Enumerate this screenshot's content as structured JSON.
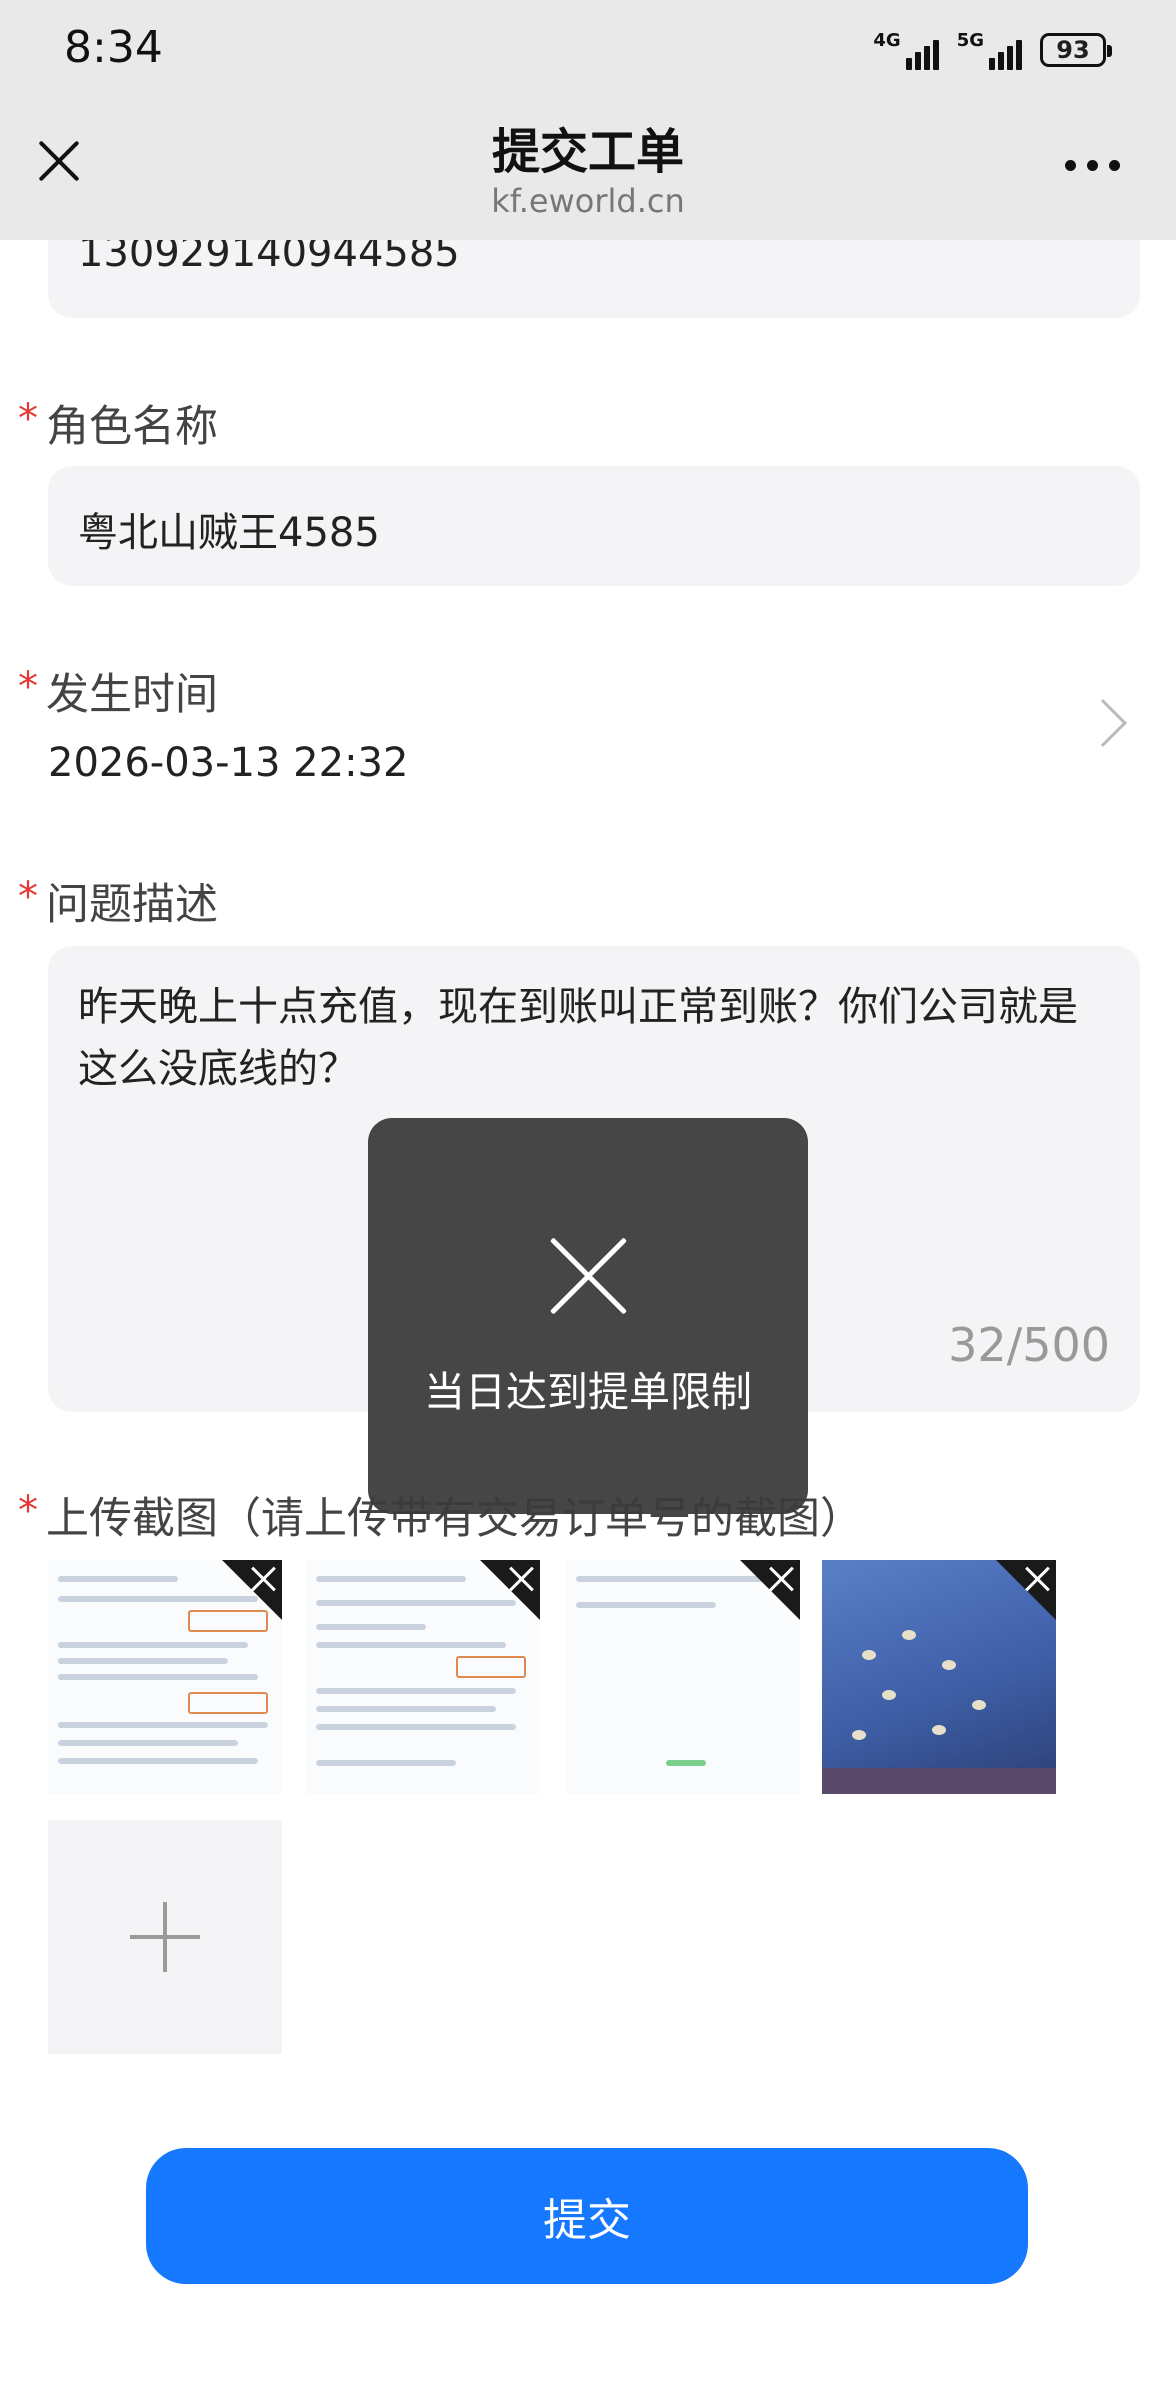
{
  "status_bar": {
    "time": "8:34",
    "network_1": "4G",
    "network_2": "5G",
    "battery": "93"
  },
  "nav": {
    "title": "提交工单",
    "subtitle": "kf.eworld.cn"
  },
  "form": {
    "order_value": "130929140944585",
    "role_label": "角色名称",
    "role_value": "粤北山贼王4585",
    "time_label": "发生时间",
    "time_value": "2026-03-13 22:32",
    "desc_label": "问题描述",
    "desc_value": "昨天晚上十点充值，现在到账叫正常到账？你们公司就是这么没底线的？",
    "desc_counter": "32/500",
    "upload_label": "上传截图（请上传带有交易订单号的截图）",
    "required_mark": "*"
  },
  "screenshots": [
    {
      "name": "screenshot-1"
    },
    {
      "name": "screenshot-2"
    },
    {
      "name": "screenshot-3"
    },
    {
      "name": "screenshot-4-game"
    }
  ],
  "submit_label": "提交",
  "toast": {
    "icon": "close-icon",
    "message": "当日达到提单限制"
  },
  "colors": {
    "accent": "#1677ff",
    "required": "#e53935",
    "toast_bg": "#3a3a3a"
  }
}
